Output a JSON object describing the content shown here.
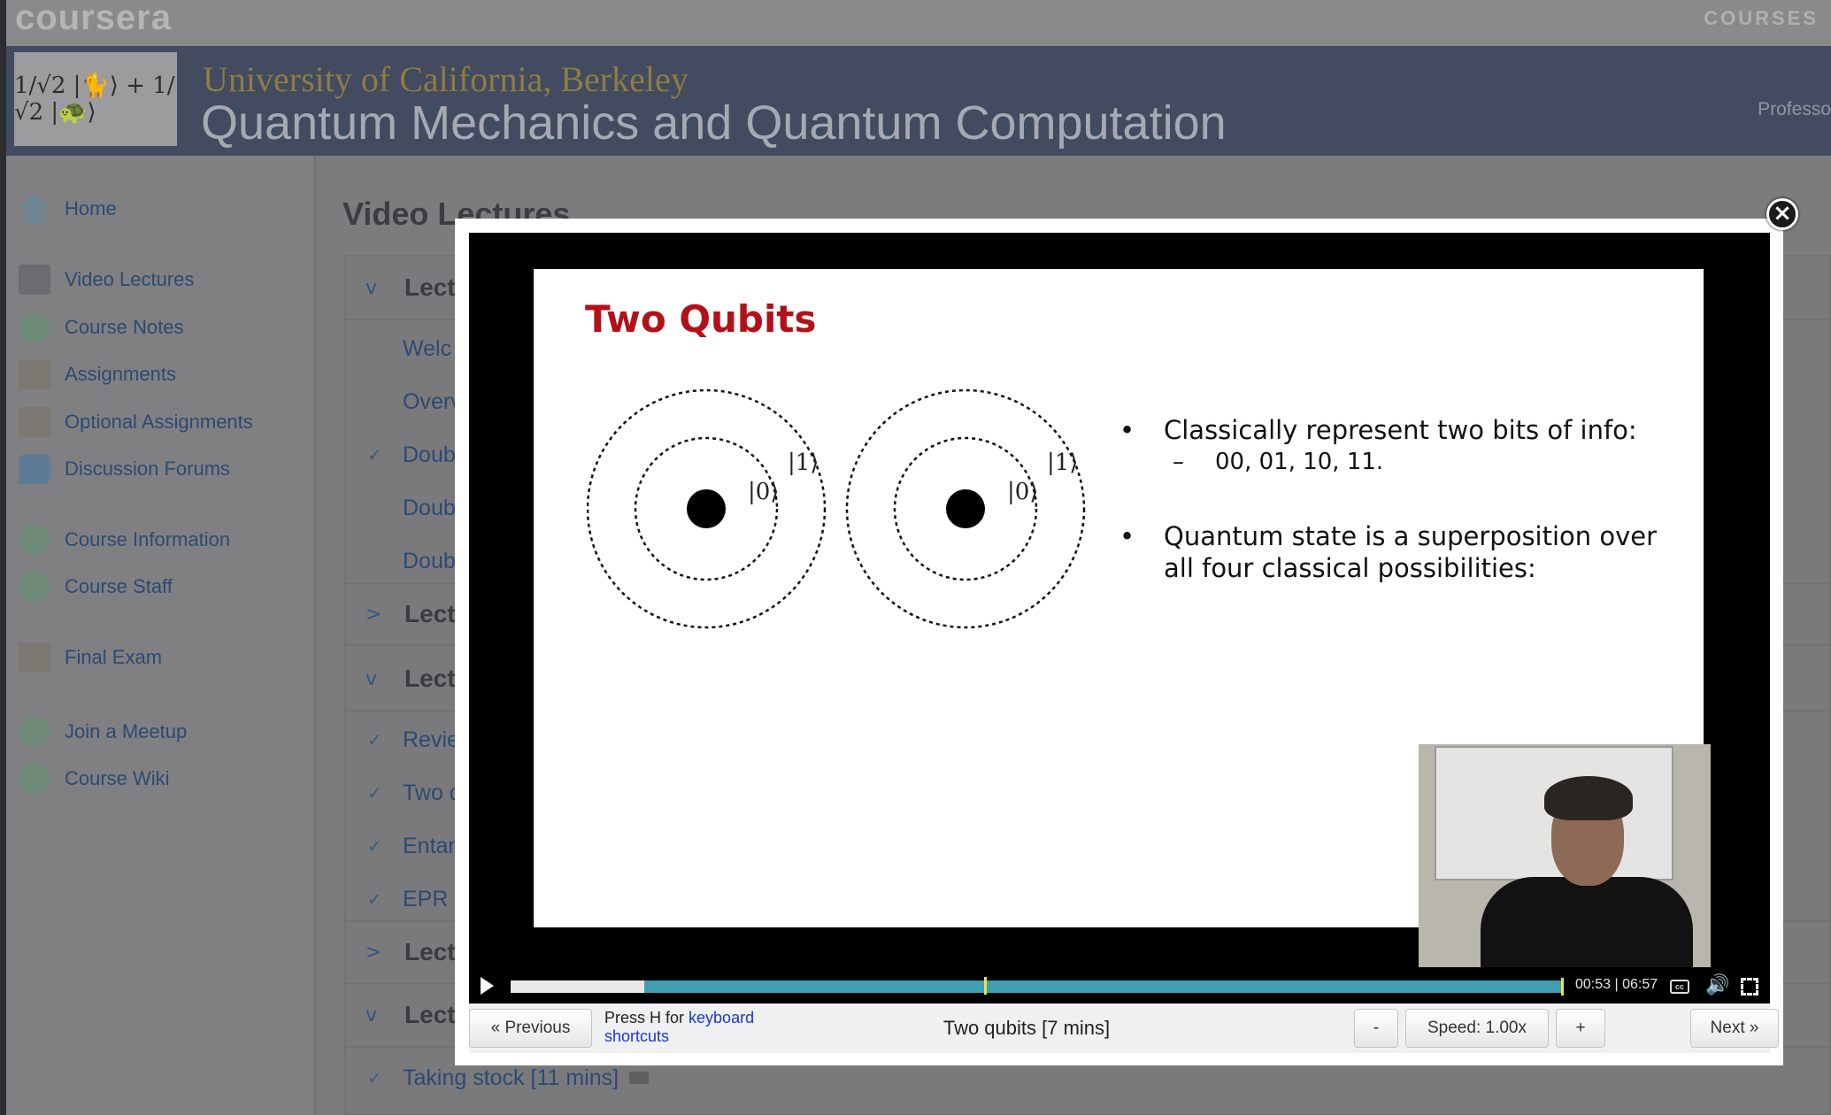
{
  "header": {
    "site_logo": "coursera",
    "courses_link": "COURSES",
    "university": "University of California, Berkeley",
    "course_title": "Quantum Mechanics and Quantum Computation",
    "professor_text": "Professo",
    "course_logo_text": "1/√2 |🐈⟩ + 1/√2 |🐢⟩"
  },
  "sidebar": {
    "items": [
      {
        "label": "Home",
        "icon": "home-icon"
      },
      {
        "label": "Video Lectures",
        "icon": "video-icon"
      },
      {
        "label": "Course Notes",
        "icon": "globe-icon"
      },
      {
        "label": "Assignments",
        "icon": "assignment-icon"
      },
      {
        "label": "Optional Assignments",
        "icon": "assignment-icon"
      },
      {
        "label": "Discussion Forums",
        "icon": "forum-icon"
      },
      {
        "label": "Course Information",
        "icon": "globe-icon"
      },
      {
        "label": "Course Staff",
        "icon": "globe-icon"
      },
      {
        "label": "Final Exam",
        "icon": "assignment-icon"
      },
      {
        "label": "Join a Meetup",
        "icon": "globe-icon"
      },
      {
        "label": "Course Wiki",
        "icon": "globe-icon"
      }
    ]
  },
  "main": {
    "heading": "Video Lectures",
    "sections": [
      {
        "chevron": "v",
        "title": "Lectu"
      },
      {
        "chevron": ">",
        "title": "Lectu"
      },
      {
        "chevron": "v",
        "title": "Lectu"
      },
      {
        "chevron": ">",
        "title": "Lectu"
      },
      {
        "chevron": "v",
        "title": "Lectu"
      }
    ],
    "lectures": [
      {
        "check": "",
        "label": "Welc"
      },
      {
        "check": "",
        "label": "Overv"
      },
      {
        "check": "✓",
        "label": "Doub"
      },
      {
        "check": "",
        "label": "Doub"
      },
      {
        "check": "",
        "label": "Doub"
      },
      {
        "check": "✓",
        "label": "Revie"
      },
      {
        "check": "✓",
        "label": "Two q"
      },
      {
        "check": "✓",
        "label": "Entan"
      },
      {
        "check": "✓",
        "label": "EPR"
      },
      {
        "check": "✓",
        "label": "Taking stock [11 mins]"
      }
    ]
  },
  "player": {
    "slide": {
      "title": "Two Qubits",
      "ket_0": "|0⟩",
      "ket_1": "|1⟩",
      "bullet_1": "Classically represent two bits of info:",
      "sub_bullet_1": "00, 01, 10, 11.",
      "bullet_2": "Quantum state is a superposition over all four classical possibilities:",
      "bullet_marker": "•",
      "sub_marker": "–"
    },
    "progress_played": 0.127,
    "progress_buffered": 0.127,
    "current_time": "00:53",
    "duration": "06:57",
    "time_display": "00:53 | 06:57",
    "cc_label": "cc",
    "volume_glyph": "🔊",
    "close_glyph": "×"
  },
  "bottom_bar": {
    "previous_label": "« Previous",
    "hint_prefix": "Press H for ",
    "hint_link_1": "keyboard",
    "hint_link_2": "shortcuts",
    "video_title": "Two qubits [7 mins]",
    "speed_down_label": "-",
    "speed_label": "Speed: 1.00x",
    "speed_up_label": "+",
    "next_label": "Next »"
  }
}
